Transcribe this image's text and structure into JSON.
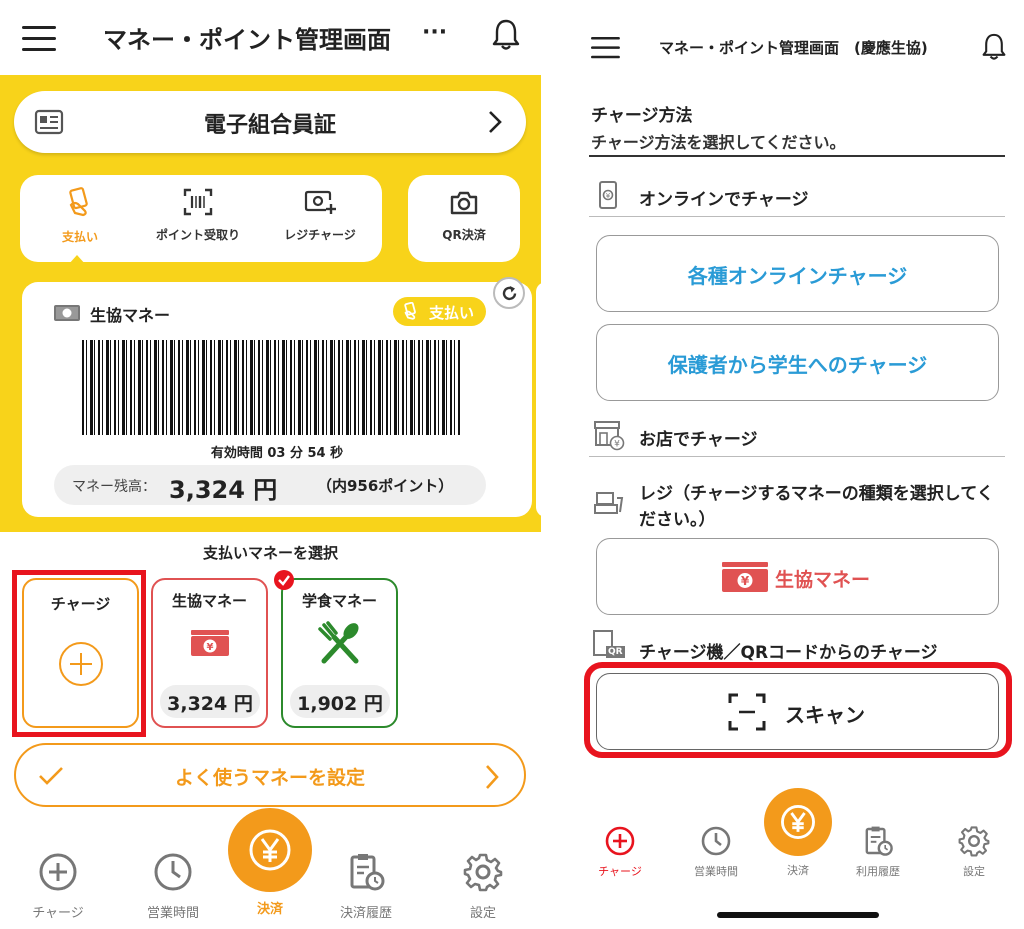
{
  "left": {
    "header": {
      "title": "マネー・ポイント管理画面",
      "more": "···"
    },
    "member_card": {
      "label": "電子組合員証"
    },
    "actions": [
      {
        "label": "支払い",
        "icon": "hand-card-icon"
      },
      {
        "label": "ポイント受取り",
        "icon": "barcode-scan-icon"
      },
      {
        "label": "レジチャージ",
        "icon": "cash-plus-icon"
      },
      {
        "label": "QR決済",
        "icon": "camera-icon"
      }
    ],
    "money_card": {
      "title": "生協マネー",
      "mode_badge": "支払い",
      "validity": "有効時間 03 分 54 秒",
      "balance_label": "マネー残高：",
      "balance_value": "3,324 円",
      "points": "（内956ポイント）"
    },
    "select_title": "支払いマネーを選択",
    "tiles": [
      {
        "label": "チャージ",
        "icon": "plus-circle-icon"
      },
      {
        "label": "生協マネー",
        "amount": "3,324 円",
        "icon": "yen-bills-icon"
      },
      {
        "label": "学食マネー",
        "amount": "1,902 円",
        "icon": "fork-spoon-icon"
      }
    ],
    "favorite_bar": {
      "label": "よく使うマネーを設定"
    },
    "nav": [
      {
        "label": "チャージ",
        "icon": "plus-circle-icon"
      },
      {
        "label": "営業時間",
        "icon": "clock-icon"
      },
      {
        "label": "決済",
        "icon": "yen-icon"
      },
      {
        "label": "決済履歴",
        "icon": "history-clipboard-icon"
      },
      {
        "label": "設定",
        "icon": "gear-icon"
      }
    ],
    "colors": {
      "brand_yellow": "#f8d31a",
      "accent_orange": "#f39a1b",
      "highlight_red": "#e8141e",
      "money_red": "#e05252",
      "meal_green": "#2c8a2c"
    }
  },
  "right": {
    "header": {
      "title": "マネー・ポイント管理画面　(慶應生協)"
    },
    "charge_method": {
      "title": "チャージ方法",
      "subtitle": "チャージ方法を選択してください。"
    },
    "online_section": {
      "title": "オンラインでチャージ"
    },
    "online_buttons": [
      "各種オンラインチャージ",
      "保護者から学生へのチャージ"
    ],
    "store_section": {
      "title": "お店でチャージ"
    },
    "register_section": {
      "title": "レジ（チャージするマネーの種類を選択してください。）"
    },
    "register_button": {
      "label": "生協マネー"
    },
    "machine_section": {
      "title": "チャージ機／QRコードからのチャージ",
      "icon_text": "QR"
    },
    "scan_button": {
      "label": "スキャン"
    },
    "nav": [
      {
        "label": "チャージ",
        "icon": "plus-circle-icon"
      },
      {
        "label": "営業時間",
        "icon": "clock-icon"
      },
      {
        "label": "決済",
        "icon": "yen-icon"
      },
      {
        "label": "利用履歴",
        "icon": "history-clipboard-icon"
      },
      {
        "label": "設定",
        "icon": "gear-icon"
      }
    ],
    "colors": {
      "link_blue": "#2a9bd6",
      "accent_orange": "#f39a1b",
      "money_red": "#e05252"
    }
  }
}
